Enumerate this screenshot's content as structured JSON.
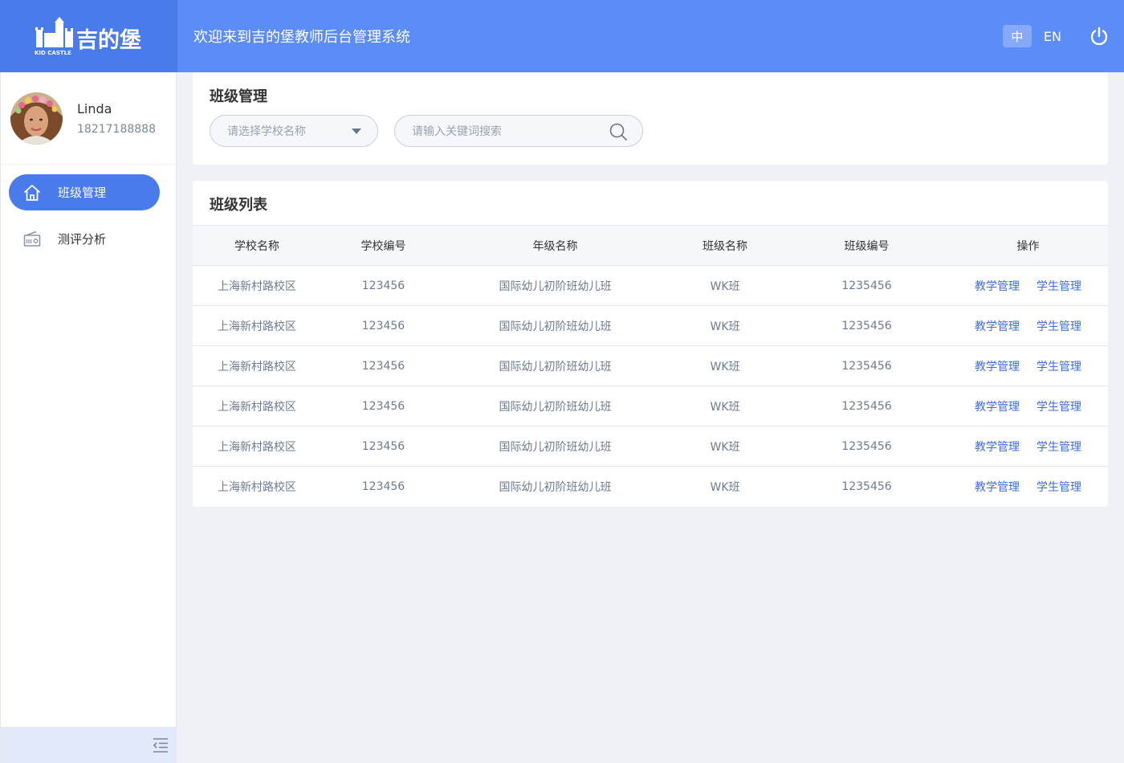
{
  "header": {
    "logo_alt": "吉的堡 KID CASTLE",
    "welcome": "欢迎来到吉的堡教师后台管理系统",
    "lang_zh": "中",
    "lang_en": "EN",
    "power_icon": "power-icon"
  },
  "profile": {
    "name": "Linda",
    "phone": "18217188888"
  },
  "sidebar": {
    "items": [
      {
        "label": "班级管理",
        "icon": "home-icon",
        "active": true
      },
      {
        "label": "测评分析",
        "icon": "radio-icon",
        "active": false
      }
    ],
    "collapse_icon": "menu-collapse-icon"
  },
  "filter": {
    "title": "班级管理",
    "school_select_placeholder": "请选择学校名称",
    "search_placeholder": "请输入关键词搜索"
  },
  "list": {
    "title": "班级列表",
    "columns": [
      "学校名称",
      "学校编号",
      "年级名称",
      "班级名称",
      "班级编号",
      "操作"
    ],
    "rows": [
      {
        "school": "上海新村路校区",
        "school_no": "123456",
        "grade": "国际幼儿初阶班幼儿班",
        "class_name": "WK班",
        "class_no": "1235456"
      },
      {
        "school": "上海新村路校区",
        "school_no": "123456",
        "grade": "国际幼儿初阶班幼儿班",
        "class_name": "WK班",
        "class_no": "1235456"
      },
      {
        "school": "上海新村路校区",
        "school_no": "123456",
        "grade": "国际幼儿初阶班幼儿班",
        "class_name": "WK班",
        "class_no": "1235456"
      },
      {
        "school": "上海新村路校区",
        "school_no": "123456",
        "grade": "国际幼儿初阶班幼儿班",
        "class_name": "WK班",
        "class_no": "1235456"
      },
      {
        "school": "上海新村路校区",
        "school_no": "123456",
        "grade": "国际幼儿初阶班幼儿班",
        "class_name": "WK班",
        "class_no": "1235456"
      },
      {
        "school": "上海新村路校区",
        "school_no": "123456",
        "grade": "国际幼儿初阶班幼儿班",
        "class_name": "WK班",
        "class_no": "1235456"
      }
    ],
    "action_teaching": "教学管理",
    "action_students": "学生管理"
  },
  "colors": {
    "brand_dark": "#4a7bea",
    "brand": "#5b8cf8",
    "link": "#3d6edf"
  }
}
